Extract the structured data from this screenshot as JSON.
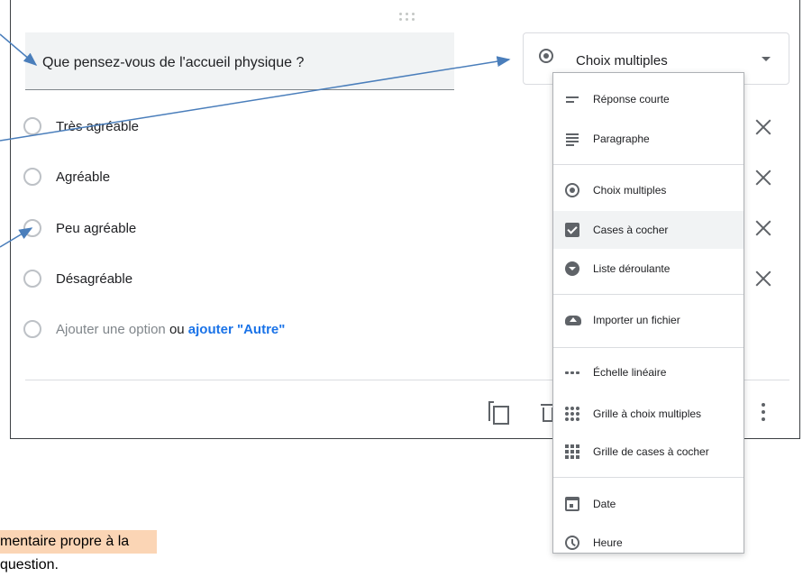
{
  "question": {
    "title": "Que pensez-vous de l'accueil physique ?"
  },
  "type_select": {
    "selected": "Choix multiples"
  },
  "options": [
    {
      "label": "Très agréable"
    },
    {
      "label": "Agréable"
    },
    {
      "label": "Peu agréable"
    },
    {
      "label": "Désagréable"
    }
  ],
  "add_option": {
    "label": "Ajouter une option",
    "or": "ou",
    "other": "ajouter \"Autre\""
  },
  "menu": {
    "items": [
      {
        "label": "Réponse courte",
        "icon": "short-answer-icon"
      },
      {
        "label": "Paragraphe",
        "icon": "paragraph-icon"
      },
      {
        "label": "Choix multiples",
        "icon": "radio-button-icon"
      },
      {
        "label": "Cases à cocher",
        "icon": "checkbox-icon"
      },
      {
        "label": "Liste déroulante",
        "icon": "dropdown-icon"
      },
      {
        "label": "Importer un fichier",
        "icon": "cloud-upload-icon"
      },
      {
        "label": "Échelle linéaire",
        "icon": "linear-scale-icon"
      },
      {
        "label": "Grille à choix multiples",
        "icon": "dot-grid-icon"
      },
      {
        "label": "Grille de cases à cocher",
        "icon": "square-grid-icon"
      },
      {
        "label": "Date",
        "icon": "calendar-icon"
      },
      {
        "label": "Heure",
        "icon": "clock-icon"
      }
    ]
  },
  "annotation": {
    "text": "mentaire propre à la question."
  },
  "colors": {
    "accent": "#1a73e8",
    "arrow": "#4a7ebb",
    "note_bg": "#fbd5b5"
  }
}
